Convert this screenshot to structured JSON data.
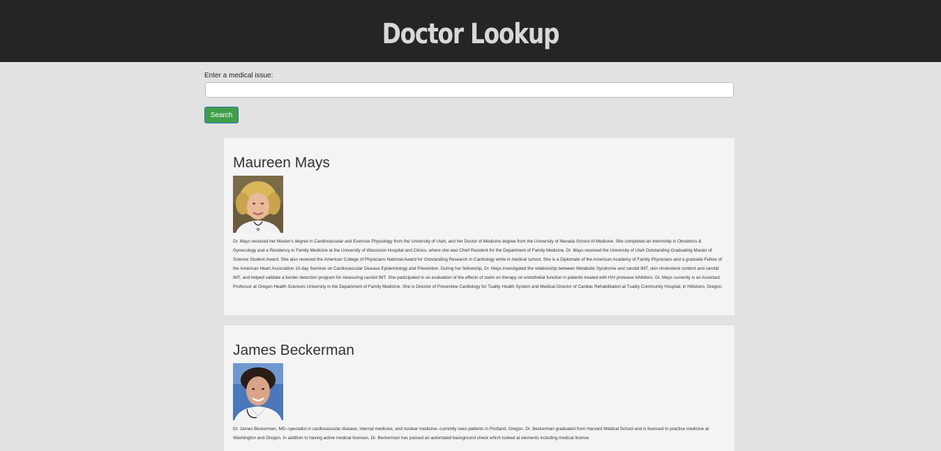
{
  "header": {
    "title": "Doctor Lookup"
  },
  "search": {
    "label": "Enter a medical issue:",
    "value": "",
    "placeholder": "",
    "button_label": "Search"
  },
  "doctors": [
    {
      "name": "Maureen Mays",
      "photo_icon": "doctor-photo",
      "bio": "Dr. Mays received her Master's degree in Cardiovascular and Exercise Physiology from the University of Utah, and her Doctor of Medicine degree from the University of Nevada School of Medicine. She completed an Internship in Obstetrics & Gynecology and a Residency in Family Medicine at the University of Wisconsin Hospital and Clinics, where she was Chief Resident for the Department of Family Medicine. Dr. Mays received the University of Utah Outstanding Graduating Master of Science Student Award. She also received the American College of Physicians National Award for Outstanding Research in Cardiology while in medical school. She is a Diplomate of the American Academy of Family Physicians and a graduate Fellow of the American Heart Association 10-day Seminar on Cardiovascular Disease Epidemiology and Prevention. During her fellowship, Dr. Mays investigated the relationship between Metabolic Syndrome and carotid IMT, skin cholesterol content and carotid IMT, and helped validate a border detection program for measuring carotid IMT. She participated in an evaluation of the effects of statin on therapy on endothelial function in patients treated with HIV protease inhibitors. Dr. Mays currently is an Assistant Professor at Oregon Health Sciences University in the Department of Family Medicine. She is Director of Preventive Cardiology for Tuality Health System and Medical Director of Cardiac Rehabilitation at Tuality Community Hospital, in Hillsboro, Oregon."
    },
    {
      "name": "James Beckerman",
      "photo_icon": "doctor-photo",
      "bio": "Dr. James Beckerman, MD--specialist in cardiovascular disease, internal medicine, and nuclear medicine--currently sees patients in Portland, Oregon. Dr. Beckerman graduated from Harvard Medical School and is licensed to practice medicine at Washington and Oregon. In addition to having active medical licenses, Dr. Beckerman has passed an automated background check which looked at elements including medical license"
    }
  ],
  "colors": {
    "header_bg": "#252527",
    "page_bg": "#e2e2e3",
    "card_bg": "#f4f4f4",
    "button_bg": "#3f9f47",
    "button_border": "#2f6fc0"
  }
}
